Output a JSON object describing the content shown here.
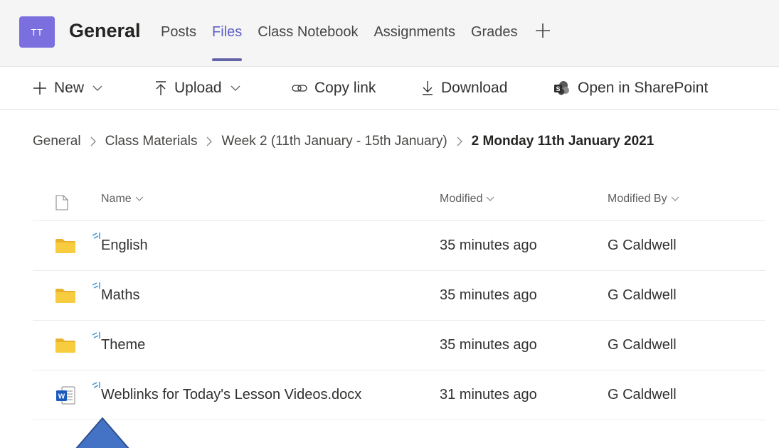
{
  "colors": {
    "avatar_bg": "#7b6fe0",
    "accent": "#6264a7",
    "folder": "#f8cc3f",
    "word_blue": "#185abd",
    "sync_blue": "#2f8fd8",
    "arrow_fill": "#4472c4",
    "arrow_stroke": "#2f528f"
  },
  "header": {
    "avatar_initials": "TT",
    "channel_title": "General",
    "tabs": [
      {
        "label": "Posts",
        "active": false
      },
      {
        "label": "Files",
        "active": true
      },
      {
        "label": "Class Notebook",
        "active": false
      },
      {
        "label": "Assignments",
        "active": false
      },
      {
        "label": "Grades",
        "active": false
      }
    ],
    "add_tab_icon": "plus-icon"
  },
  "commands": {
    "new_label": "New",
    "upload_label": "Upload",
    "copy_link_label": "Copy link",
    "download_label": "Download",
    "sharepoint_label": "Open in SharePoint"
  },
  "breadcrumb": {
    "items": [
      "General",
      "Class Materials",
      "Week 2 (11th January - 15th January)"
    ],
    "current": "2 Monday 11th January 2021"
  },
  "table": {
    "columns": {
      "name": "Name",
      "modified": "Modified",
      "modified_by": "Modified By"
    },
    "rows": [
      {
        "type": "folder",
        "name": "English",
        "modified": "35 minutes ago",
        "modified_by": "G Caldwell"
      },
      {
        "type": "folder",
        "name": "Maths",
        "modified": "35 minutes ago",
        "modified_by": "G Caldwell"
      },
      {
        "type": "folder",
        "name": "Theme",
        "modified": "35 minutes ago",
        "modified_by": "G Caldwell"
      },
      {
        "type": "word-document",
        "name": "Weblinks for Today's Lesson Videos.docx",
        "modified": "31 minutes ago",
        "modified_by": "G Caldwell"
      }
    ]
  }
}
